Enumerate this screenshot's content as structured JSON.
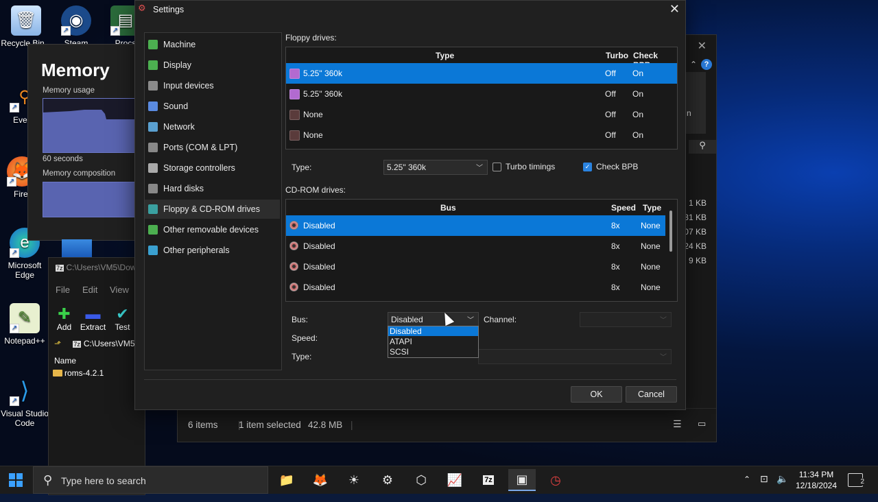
{
  "desktop": {
    "icons": [
      {
        "label": "Recycle Bin"
      },
      {
        "label": "Steam"
      },
      {
        "label": "Procs"
      },
      {
        "label": "Everyt"
      },
      {
        "label": "Firef"
      },
      {
        "label": "Microsoft Edge"
      },
      {
        "label": "Notepad++"
      },
      {
        "label": "Visual Studio Code"
      }
    ]
  },
  "task_manager": {
    "title": "Memory",
    "usage_label": "Memory usage",
    "time_label": "60 seconds",
    "composition_label": "Memory composition"
  },
  "sevenzip": {
    "title": "C:\\Users\\VM5\\Dow",
    "menu": [
      "File",
      "Edit",
      "View"
    ],
    "tools": [
      "Add",
      "Extract",
      "Test"
    ],
    "address": "C:\\Users\\VM5",
    "column_name": "Name",
    "rows": [
      "roms-4.2.1"
    ]
  },
  "explorer": {
    "status_items": "6 items",
    "status_selected": "1 item selected",
    "status_size": "42.8 MB",
    "partial_text": "n",
    "sizes": [
      "1 KB",
      "31 KB",
      "07 KB",
      "24 KB",
      "9 KB"
    ]
  },
  "settings": {
    "title": "Settings",
    "nav": [
      {
        "label": "Machine",
        "icon": "machine-icon",
        "color": "#4caf50"
      },
      {
        "label": "Display",
        "icon": "display-icon",
        "color": "#4caf50"
      },
      {
        "label": "Input devices",
        "icon": "input-devices-icon",
        "color": "#8a8a8a"
      },
      {
        "label": "Sound",
        "icon": "sound-icon",
        "color": "#5a8ae0"
      },
      {
        "label": "Network",
        "icon": "network-icon",
        "color": "#5aa0d0"
      },
      {
        "label": "Ports (COM & LPT)",
        "icon": "ports-icon",
        "color": "#888"
      },
      {
        "label": "Storage controllers",
        "icon": "storage-icon",
        "color": "#aaa"
      },
      {
        "label": "Hard disks",
        "icon": "hard-disk-icon",
        "color": "#888"
      },
      {
        "label": "Floppy & CD-ROM drives",
        "icon": "floppy-cdrom-icon",
        "color": "#3aa0a0"
      },
      {
        "label": "Other removable devices",
        "icon": "removable-icon",
        "color": "#4caf50"
      },
      {
        "label": "Other peripherals",
        "icon": "peripherals-icon",
        "color": "#3aa0d0"
      }
    ],
    "selected_nav": "Floppy & CD-ROM drives",
    "floppy": {
      "section_label": "Floppy drives:",
      "headers": {
        "type": "Type",
        "turbo": "Turbo",
        "check_bpb": "Check BPB"
      },
      "rows": [
        {
          "type": "5.25\" 360k",
          "turbo": "Off",
          "check_bpb": "On",
          "selected": true,
          "icon": "floppy-drive-icon"
        },
        {
          "type": "5.25\" 360k",
          "turbo": "Off",
          "check_bpb": "On",
          "selected": false,
          "icon": "floppy-drive-icon"
        },
        {
          "type": "None",
          "turbo": "Off",
          "check_bpb": "On",
          "selected": false,
          "icon": "floppy-none-icon"
        },
        {
          "type": "None",
          "turbo": "Off",
          "check_bpb": "On",
          "selected": false,
          "icon": "floppy-none-icon"
        }
      ],
      "type_label": "Type:",
      "type_value": "5.25\" 360k",
      "turbo_label": "Turbo timings",
      "turbo_checked": false,
      "check_bpb_label": "Check BPB",
      "check_bpb_checked": true
    },
    "cdrom": {
      "section_label": "CD-ROM drives:",
      "headers": {
        "bus": "Bus",
        "speed": "Speed",
        "type": "Type"
      },
      "rows": [
        {
          "bus": "Disabled",
          "speed": "8x",
          "type": "None",
          "selected": true
        },
        {
          "bus": "Disabled",
          "speed": "8x",
          "type": "None",
          "selected": false
        },
        {
          "bus": "Disabled",
          "speed": "8x",
          "type": "None",
          "selected": false
        },
        {
          "bus": "Disabled",
          "speed": "8x",
          "type": "None",
          "selected": false
        }
      ],
      "bus_label": "Bus:",
      "bus_value": "Disabled",
      "channel_label": "Channel:",
      "speed_label": "Speed:",
      "type_label": "Type:",
      "bus_options": [
        {
          "label": "Disabled",
          "selected": true
        },
        {
          "label": "ATAPI",
          "selected": false
        },
        {
          "label": "SCSI",
          "selected": false
        }
      ]
    },
    "ok_label": "OK",
    "cancel_label": "Cancel"
  },
  "taskbar": {
    "search_placeholder": "Type here to search",
    "apps": [
      {
        "icon": "file-explorer-icon",
        "glyph": "📁"
      },
      {
        "icon": "firefox-icon",
        "glyph": "🦊"
      },
      {
        "icon": "app-sun-icon",
        "glyph": "☀"
      },
      {
        "icon": "settings-gear-icon",
        "glyph": "⚙"
      },
      {
        "icon": "cube-app-icon",
        "glyph": "⬡"
      },
      {
        "icon": "task-manager-icon",
        "glyph": "📈"
      },
      {
        "icon": "sevenzip-icon",
        "glyph": "7z"
      },
      {
        "icon": "86box-icon",
        "glyph": "▣"
      },
      {
        "icon": "clock-app-icon",
        "glyph": "◷"
      }
    ],
    "time": "11:34 PM",
    "date": "12/18/2024",
    "notification_count": "2",
    "accent": "#0b78d7"
  }
}
